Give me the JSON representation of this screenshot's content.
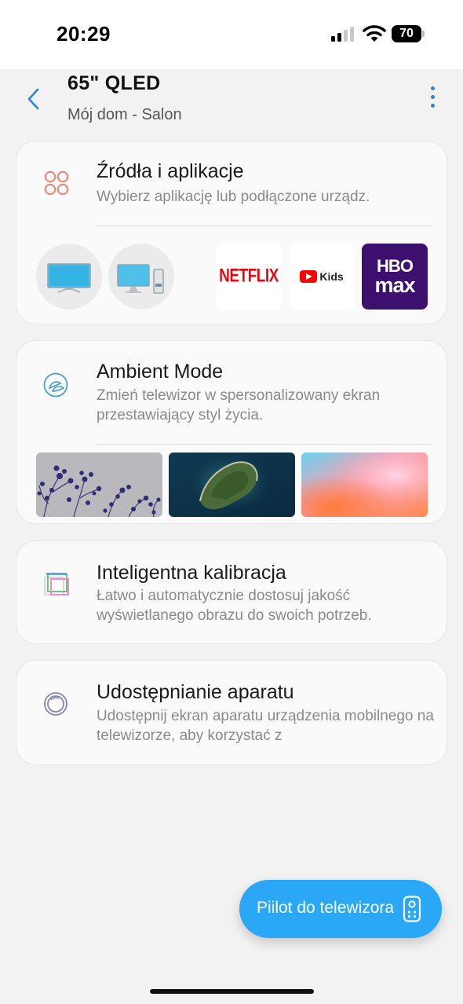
{
  "status_bar": {
    "time": "20:29",
    "battery": "70",
    "signal_bars": 4,
    "signal_active": 2
  },
  "header": {
    "title": "65\" QLED",
    "subtitle": "Mój dom - Salon"
  },
  "sources_card": {
    "title": "Źródła i aplikacje",
    "description": "Wybierz aplikację lub podłączone urządz.",
    "devices": [
      "tv-icon",
      "pc-icon"
    ],
    "apps": [
      {
        "name": "NETFLIX"
      },
      {
        "name": "Kids"
      },
      {
        "name_top": "HBO",
        "name_bottom": "max"
      }
    ]
  },
  "ambient_card": {
    "title": "Ambient Mode",
    "description": "Zmień telewizor w spersonalizowany ekran przestawiający styl życia."
  },
  "calibration_card": {
    "title": "Inteligentna kalibracja",
    "description": "Łatwo i automatycznie dostosuj jakość wyświetlanego obrazu do swoich potrzeb."
  },
  "camera_card": {
    "title": "Udostępnianie aparatu",
    "description": "Udostępnij ekran aparatu urządzenia mobilnego na telewizorze, aby korzystać z"
  },
  "remote_button": {
    "label": "Piilot do telewizora"
  },
  "colors": {
    "accent": "#2aa7f5",
    "header_icons": "#2f84d4",
    "sources_icon": "#f08a78",
    "background": "#f2f2f2"
  }
}
